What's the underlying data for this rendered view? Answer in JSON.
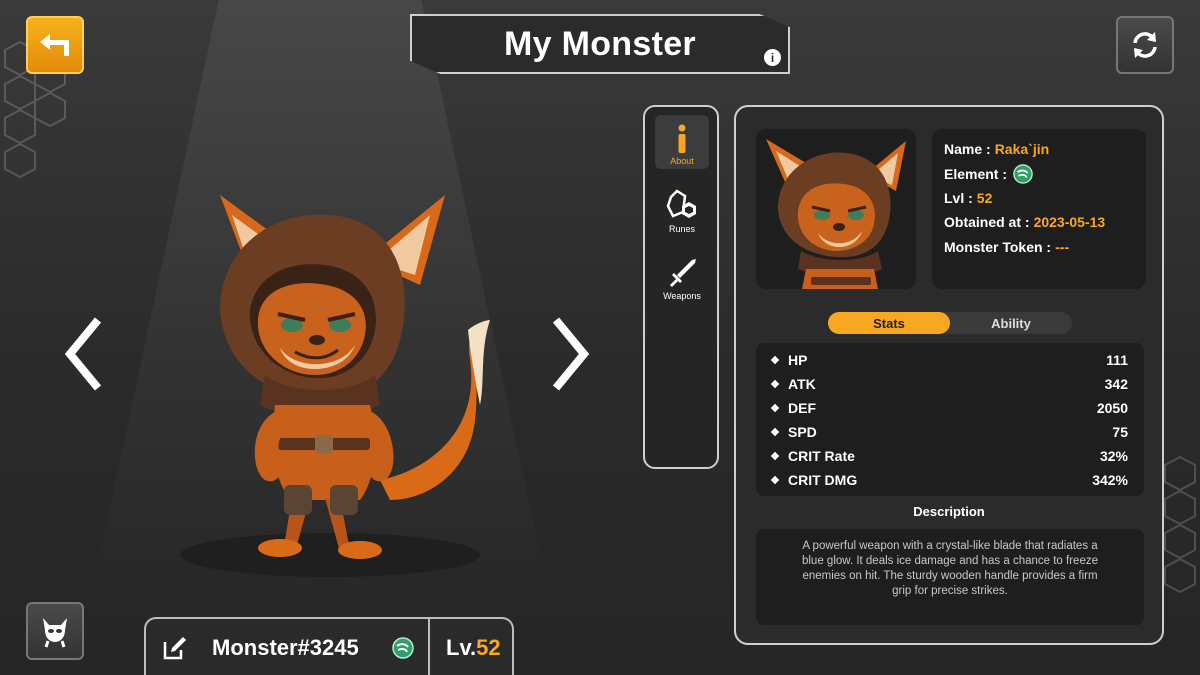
{
  "header": {
    "title": "My Monster"
  },
  "tabs": [
    {
      "label": "About",
      "icon": "info-icon"
    },
    {
      "label": "Runes",
      "icon": "runes-icon"
    },
    {
      "label": "Weapons",
      "icon": "sword-icon"
    }
  ],
  "monster": {
    "display_name": "Monster#3245",
    "level_prefix": "Lv.",
    "level": "52"
  },
  "details": {
    "name_label": "Name :",
    "name": "Raka`jin",
    "element_label": "Element :",
    "element_icon": "wind-element-icon",
    "lvl_label": "Lvl :",
    "lvl": "52",
    "obtained_label": "Obtained at :",
    "obtained": "2023-05-13",
    "token_label": "Monster Token :",
    "token": "---"
  },
  "toggle": {
    "stats": "Stats",
    "ability": "Ability",
    "active": "Stats"
  },
  "stats": [
    {
      "name": "HP",
      "value": "111"
    },
    {
      "name": "ATK",
      "value": "342"
    },
    {
      "name": "DEF",
      "value": "2050"
    },
    {
      "name": "SPD",
      "value": "75"
    },
    {
      "name": "CRIT Rate",
      "value": "32%"
    },
    {
      "name": "CRIT DMG",
      "value": "342%"
    }
  ],
  "description": {
    "title": "Description",
    "text": "A powerful weapon with a crystal-like blade that radiates a blue glow. It deals ice damage and has a chance to freeze enemies on hit. The sturdy wooden handle provides a firm grip for precise strikes."
  },
  "colors": {
    "accent": "#f7a820",
    "panel": "#2b2b2b",
    "inner": "#1e1e1e",
    "element": "#2e9e6a"
  }
}
